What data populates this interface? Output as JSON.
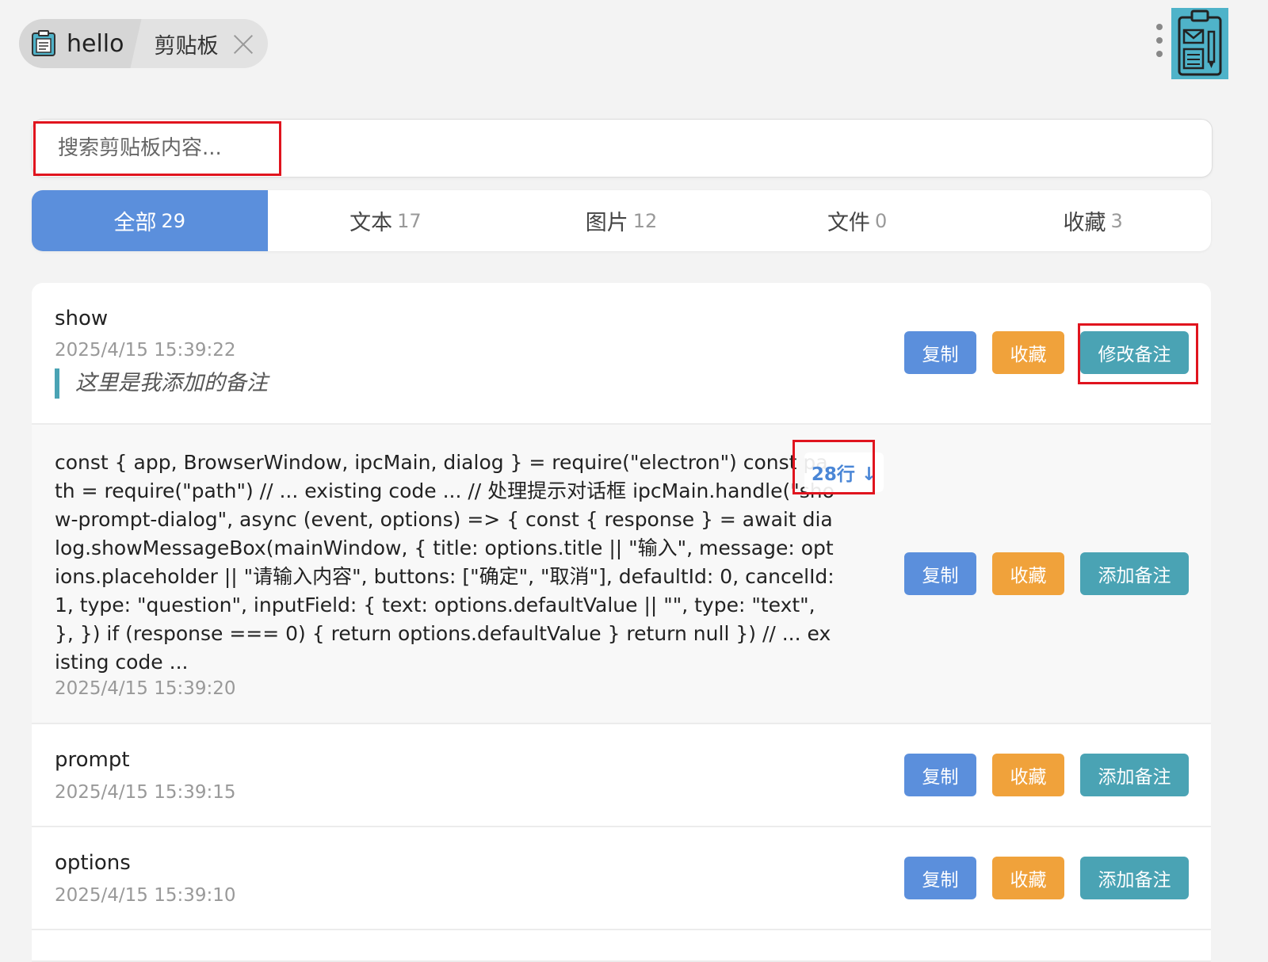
{
  "header": {
    "app_name": "hello",
    "sub_tab": "剪贴板",
    "app_icon": "clipboard-icon",
    "more_icon": "more-vertical-icon",
    "logo_icon": "clipboard-mail-logo-icon"
  },
  "search": {
    "placeholder": "搜索剪贴板内容...",
    "value": ""
  },
  "categories": [
    {
      "label": "全部",
      "count": "29",
      "active": true
    },
    {
      "label": "文本",
      "count": "17",
      "active": false
    },
    {
      "label": "图片",
      "count": "12",
      "active": false
    },
    {
      "label": "文件",
      "count": "0",
      "active": false
    },
    {
      "label": "收藏",
      "count": "3",
      "active": false
    }
  ],
  "items": [
    {
      "title": "show",
      "time": "2025/4/15 15:39:22",
      "note": "这里是我添加的备注",
      "copy_label": "复制",
      "fav_label": "收藏",
      "note_label": "修改备注"
    },
    {
      "content": "const { app, BrowserWindow, ipcMain, dialog } = require(\"electron\") const path = require(\"path\") // ... existing code ... // 处理提示对话框 ipcMain.handle(\"show-prompt-dialog\", async (event, options) => { const { response } = await dialog.showMessageBox(mainWindow, { title: options.title || \"输入\", message: options.placeholder || \"请输入内容\", buttons: [\"确定\", \"取消\"], defaultId: 0, cancelId: 1, type: \"question\", inputField: { text: options.defaultValue || \"\", type: \"text\", }, }) if (response === 0) { return options.defaultValue } return null }) // ... existing code ...",
      "lines_badge": "28行 ↓",
      "time": "2025/4/15 15:39:20",
      "copy_label": "复制",
      "fav_label": "收藏",
      "note_label": "添加备注"
    },
    {
      "title": "prompt",
      "time": "2025/4/15 15:39:15",
      "copy_label": "复制",
      "fav_label": "收藏",
      "note_label": "添加备注"
    },
    {
      "title": "options",
      "time": "2025/4/15 15:39:10",
      "copy_label": "复制",
      "fav_label": "收藏",
      "note_label": "添加备注"
    }
  ],
  "colors": {
    "primary": "#5b8fdc",
    "favorite": "#f0a23b",
    "note": "#4aa3b4",
    "highlight": "#e0141e"
  }
}
